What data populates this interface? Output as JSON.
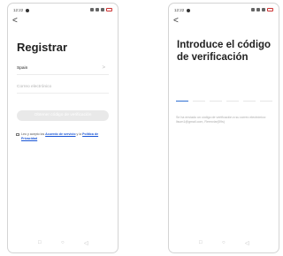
{
  "status_bar": {
    "time": "12:22"
  },
  "register_screen": {
    "back_label": "<",
    "title": "Registrar",
    "country_value": "Spain",
    "country_chevron": ">",
    "email_placeholder": "Correo electrónico",
    "send_code_button": "Obtener código de verificación",
    "agreement_prefix": "Leo y acepto los ",
    "service_agreement_link": "Acuerdo de servicio",
    "agreement_and": " y la ",
    "privacy_policy_link": "Política de Privacidad"
  },
  "verify_screen": {
    "back_label": "<",
    "title": "Introduce el código de verificación",
    "code_slots": 6,
    "info_text": "Se ha enviado un código de verificación a su correo electrónico: lisum1@gmail.com, Reenviar(59s)"
  },
  "nav_bar": {
    "square_icon": "□",
    "circle_icon": "○",
    "back_icon": "◁"
  }
}
